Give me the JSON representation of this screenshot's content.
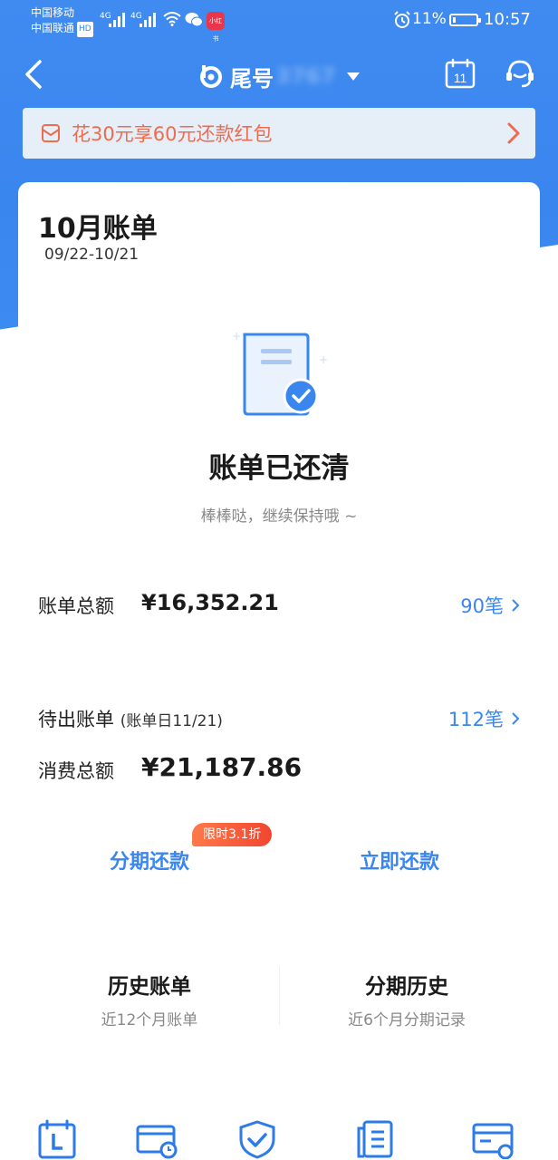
{
  "status_bar": {
    "carrier1": "中国移动",
    "carrier2": "中国联通",
    "hd": "HD",
    "net1": "4G",
    "net2": "4G",
    "app_badge": "小红书",
    "battery_pct": "11%",
    "time": "10:57"
  },
  "nav": {
    "title": "尾号",
    "title_masked": "3767",
    "calendar_day": "11"
  },
  "promo": {
    "text": "花30元享60元还款红包"
  },
  "bill": {
    "month_title": "10月账单",
    "date_range": "09/22-10/21",
    "paid_title": "账单已还清",
    "paid_sub": "棒棒哒，继续保持哦 ~",
    "total_label": "账单总额",
    "total_amount": "¥16,352.21",
    "total_count": "90笔",
    "pending_label": "待出账单",
    "pending_sub": "(账单日11/21)",
    "pending_count": "112笔",
    "spend_label": "消费总额",
    "spend_amount": "¥21,187.86"
  },
  "actions": {
    "installment": "分期还款",
    "discount_badge": "限时3.1折",
    "repay_now": "立即还款"
  },
  "history": {
    "bills_title": "历史账单",
    "bills_sub": "近12个月账单",
    "installment_title": "分期历史",
    "installment_sub": "近6个月分期记录"
  },
  "colors": {
    "primary": "#3a86ef",
    "promo_text": "#ee6b4e",
    "badge": "#f2452f"
  },
  "icons": [
    "back-icon",
    "bank-logo-icon",
    "dropdown-icon",
    "calendar-icon",
    "customer-service-icon",
    "promo-envelope-icon",
    "chevron-right-icon",
    "bill-paid-icon",
    "tab-calendar-icon",
    "tab-bill-history-icon",
    "tab-shield-icon",
    "tab-document-icon",
    "tab-card-icon"
  ]
}
